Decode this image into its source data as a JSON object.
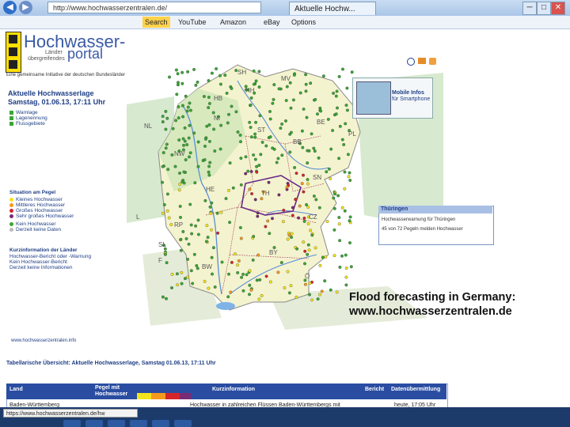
{
  "browser": {
    "url": "http://www.hochwasserzentralen.de/",
    "tab_title": "Aktuelle Hochw...",
    "window_buttons": [
      "─",
      "□",
      "✕"
    ],
    "favorites": [
      "Search",
      "YouTube",
      "Amazon",
      "eBay",
      "Options"
    ],
    "status_url": "https://www.hochwasserzentralen.de/hw"
  },
  "site": {
    "logo_title": "Hochwasser-",
    "logo_title2": "portal",
    "logo_sub1": "Länder",
    "logo_sub2": "übergreifendes",
    "tagline": "Eine gemeinsame Initiative der deutschen Bundesländer",
    "heading": "Aktuelle Hochwasserlage",
    "date": "Samstag, 01.06.13, 17:11 Uhr",
    "links": [
      "Warnlage",
      "Lagenennung",
      "Flussgebiete"
    ],
    "legend_title": "Situation am Pegel",
    "legend": [
      {
        "label": "Kleines Hochwasser",
        "color": "#f2e31b"
      },
      {
        "label": "Mittleres Hochwasser",
        "color": "#f39a1d"
      },
      {
        "label": "Großes Hochwasser",
        "color": "#d4252b"
      },
      {
        "label": "Sehr großes Hochwasser",
        "color": "#7a2a74"
      },
      {
        "label": "Kein Hochwasser",
        "color": "#3aa635"
      },
      {
        "label": "Derzeit keine Daten",
        "color": "#bbbbbb"
      }
    ],
    "land_info_title": "Kurzinformation der Länder",
    "land_info": [
      "Hochwasser-Bericht oder -Warnung",
      "Kein Hochwasser-Bericht",
      "Derzeit keine Informationen"
    ],
    "mobile_info": [
      "Mobile Infos",
      "für Smartphone"
    ],
    "thueringen": {
      "title": "Thüringen",
      "line1": "Hochwasserwarnung für Thüringen",
      "line2": "45 von 72 Pegeln melden Hochwasser"
    },
    "footer_link": "www.hochwasserzentralen.info",
    "table_title": "Tabellarische Übersicht: Aktuelle Hochwasserlage, Samstag 01.06.13, 17:11 Uhr",
    "table_headers": [
      "Land",
      "Pegel mit Hochwasser",
      "Kurzinformation",
      "Bericht",
      "Datenübermittlung"
    ],
    "table_row": [
      "Baden-Württemberg",
      "Hochwasser in zahlreichen Flüssen Baden-Württembergs mit",
      "heute, 17:05 Uhr"
    ],
    "state_labels": [
      "SH",
      "MV",
      "HH",
      "HB",
      "NI",
      "ST",
      "BB",
      "BE",
      "NW",
      "SN",
      "TH",
      "HE",
      "RP",
      "SL",
      "BW",
      "BY",
      "NL",
      "PL",
      "CZ",
      "Ö",
      "L",
      "F"
    ]
  },
  "caption": {
    "line1": "Flood forecasting in Germany:",
    "line2": "www.hochwasserzentralen.de"
  },
  "colors": {
    "accent": "#1f3f86",
    "table_header": "#2a4da1",
    "land": "#eef0c8",
    "neighbour_green": "#bfe0b2",
    "taskbar": "#1c3b6b"
  }
}
